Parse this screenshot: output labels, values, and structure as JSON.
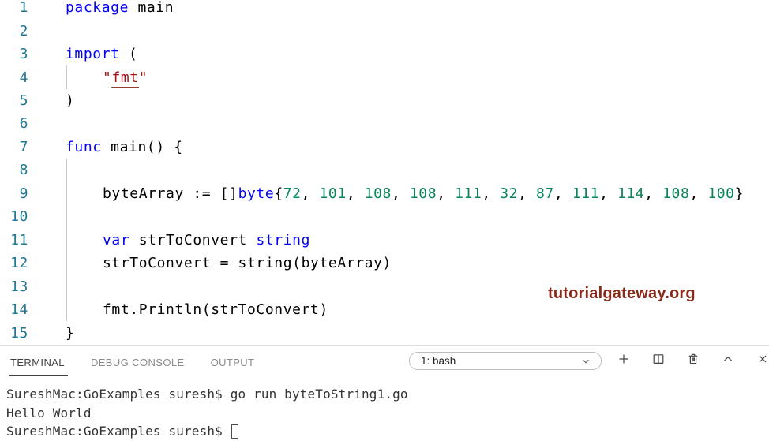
{
  "colors": {
    "keyword": "#0000ff",
    "number_literal": "#098658",
    "string_literal": "#a31515",
    "line_number": "#237893",
    "watermark": "#8a291a",
    "panel_icon": "#424242"
  },
  "editor": {
    "lines": [
      {
        "num": "1",
        "guide": false,
        "indent": false,
        "segments": [
          {
            "t": "package",
            "s": "kw"
          },
          {
            "t": " main",
            "s": "pl"
          }
        ]
      },
      {
        "num": "2",
        "guide": false,
        "indent": false,
        "segments": []
      },
      {
        "num": "3",
        "guide": false,
        "indent": false,
        "segments": [
          {
            "t": "import",
            "s": "kw"
          },
          {
            "t": " (",
            "s": "pl"
          }
        ]
      },
      {
        "num": "4",
        "guide": true,
        "indent": true,
        "segments": [
          {
            "t": "\"",
            "s": "str"
          },
          {
            "t": "fmt",
            "s": "stru"
          },
          {
            "t": "\"",
            "s": "str"
          }
        ]
      },
      {
        "num": "5",
        "guide": false,
        "indent": false,
        "segments": [
          {
            "t": ")",
            "s": "pl"
          }
        ]
      },
      {
        "num": "6",
        "guide": false,
        "indent": false,
        "segments": []
      },
      {
        "num": "7",
        "guide": false,
        "indent": false,
        "segments": [
          {
            "t": "func",
            "s": "kw"
          },
          {
            "t": " main() {",
            "s": "pl"
          }
        ]
      },
      {
        "num": "8",
        "guide": true,
        "indent": false,
        "segments": []
      },
      {
        "num": "9",
        "guide": true,
        "indent": true,
        "segments": [
          {
            "t": "byteArray := []",
            "s": "pl"
          },
          {
            "t": "byte",
            "s": "kw"
          },
          {
            "t": "{",
            "s": "pl"
          },
          {
            "t": "72",
            "s": "num"
          },
          {
            "t": ", ",
            "s": "pl"
          },
          {
            "t": "101",
            "s": "num"
          },
          {
            "t": ", ",
            "s": "pl"
          },
          {
            "t": "108",
            "s": "num"
          },
          {
            "t": ", ",
            "s": "pl"
          },
          {
            "t": "108",
            "s": "num"
          },
          {
            "t": ", ",
            "s": "pl"
          },
          {
            "t": "111",
            "s": "num"
          },
          {
            "t": ", ",
            "s": "pl"
          },
          {
            "t": "32",
            "s": "num"
          },
          {
            "t": ", ",
            "s": "pl"
          },
          {
            "t": "87",
            "s": "num"
          },
          {
            "t": ", ",
            "s": "pl"
          },
          {
            "t": "111",
            "s": "num"
          },
          {
            "t": ", ",
            "s": "pl"
          },
          {
            "t": "114",
            "s": "num"
          },
          {
            "t": ", ",
            "s": "pl"
          },
          {
            "t": "108",
            "s": "num"
          },
          {
            "t": ", ",
            "s": "pl"
          },
          {
            "t": "100",
            "s": "num"
          },
          {
            "t": "}",
            "s": "pl"
          }
        ]
      },
      {
        "num": "10",
        "guide": true,
        "indent": false,
        "segments": []
      },
      {
        "num": "11",
        "guide": true,
        "indent": true,
        "segments": [
          {
            "t": "var",
            "s": "kw"
          },
          {
            "t": " strToConvert ",
            "s": "pl"
          },
          {
            "t": "string",
            "s": "kw"
          }
        ]
      },
      {
        "num": "12",
        "guide": true,
        "indent": true,
        "segments": [
          {
            "t": "strToConvert = string(byteArray)",
            "s": "pl"
          }
        ]
      },
      {
        "num": "13",
        "guide": true,
        "indent": false,
        "segments": []
      },
      {
        "num": "14",
        "guide": true,
        "indent": true,
        "segments": [
          {
            "t": "fmt.Println(strToConvert)",
            "s": "pl"
          }
        ]
      },
      {
        "num": "15",
        "guide": false,
        "indent": false,
        "segments": [
          {
            "t": "}",
            "s": "pl"
          }
        ]
      }
    ]
  },
  "watermark": {
    "text": "tutorialgateway.org"
  },
  "panel": {
    "tabs": [
      {
        "label": "TERMINAL",
        "active": true
      },
      {
        "label": "DEBUG CONSOLE",
        "active": false
      },
      {
        "label": "OUTPUT",
        "active": false
      }
    ],
    "shell_selector": {
      "value": "1: bash"
    },
    "action_icons": [
      "plus-icon",
      "split-terminal-icon",
      "trash-icon",
      "chevron-up-icon",
      "close-icon"
    ]
  },
  "terminal": {
    "lines": [
      {
        "text": "SureshMac:GoExamples suresh$ go run byteToString1.go",
        "cursor": false
      },
      {
        "text": "Hello World",
        "cursor": false
      },
      {
        "text": "SureshMac:GoExamples suresh$ ",
        "cursor": true
      }
    ]
  }
}
